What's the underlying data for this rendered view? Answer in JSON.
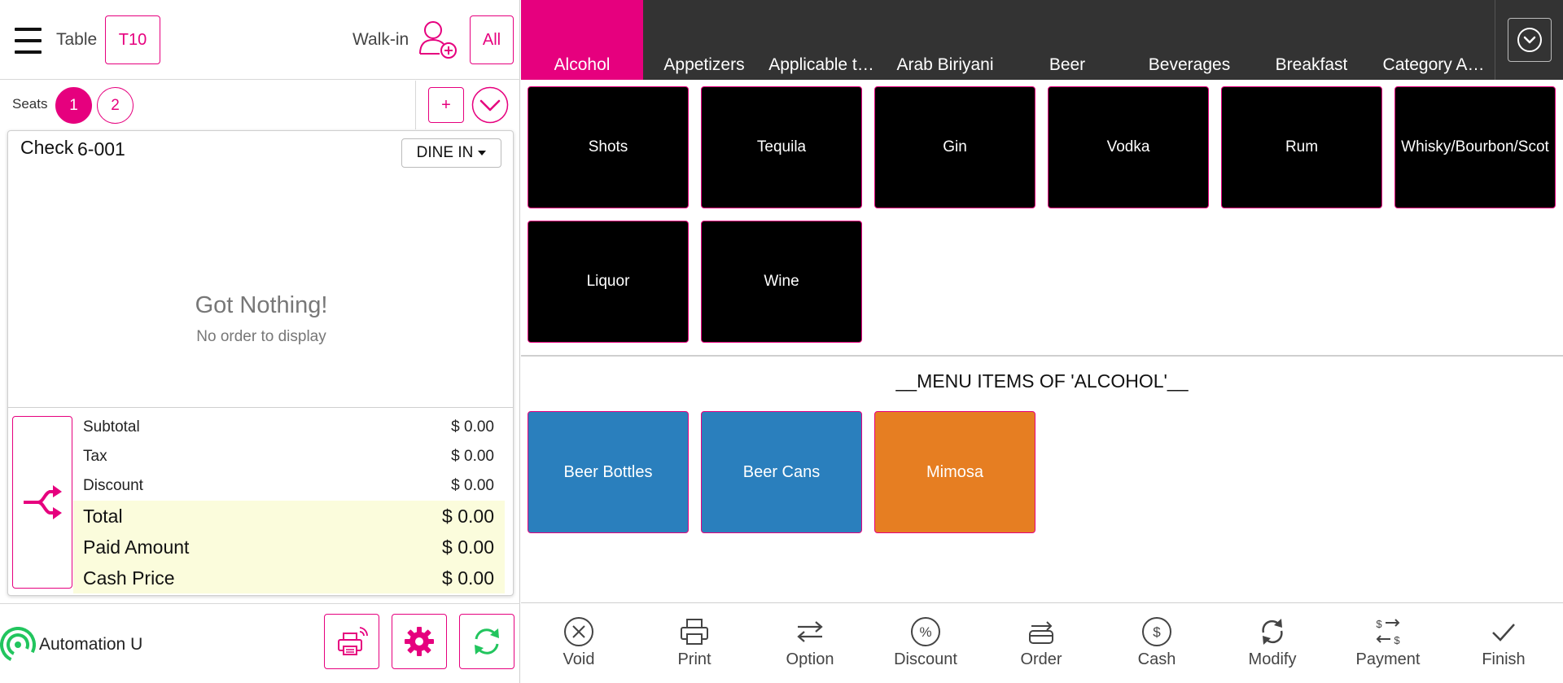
{
  "header": {
    "table_label": "Table",
    "table_value": "T10",
    "walkin_label": "Walk-in",
    "all_label": "All"
  },
  "seats": {
    "label": "Seats",
    "items": [
      "1",
      "2"
    ],
    "active": "1",
    "add_label": "+"
  },
  "check": {
    "label": "Check",
    "number": "6-001",
    "order_type": "DINE IN",
    "empty_title": "Got Nothing!",
    "empty_subtitle": "No order to display"
  },
  "totals": [
    {
      "label": "Subtotal",
      "value": "$ 0.00"
    },
    {
      "label": "Tax",
      "value": "$ 0.00"
    },
    {
      "label": "Discount",
      "value": "$ 0.00"
    },
    {
      "label": "Total",
      "value": "$ 0.00"
    },
    {
      "label": "Paid Amount",
      "value": "$ 0.00"
    },
    {
      "label": "Cash Price",
      "value": "$ 0.00"
    }
  ],
  "footer_left": {
    "user_name": "Automation U"
  },
  "categories": {
    "tabs": [
      "Alcohol",
      "Appetizers",
      "Applicable t…",
      "Arab Biriyani",
      "Beer",
      "Beverages",
      "Breakfast",
      "Category A…"
    ],
    "active": "Alcohol"
  },
  "subcategories": [
    "Shots",
    "Tequila",
    "Gin",
    "Vodka",
    "Rum",
    "Whisky/Bourbon/Scot",
    "Liquor",
    "Wine"
  ],
  "menu": {
    "title": "__MENU ITEMS OF 'ALCOHOL'__",
    "items": [
      {
        "label": "Beer Bottles",
        "color": "#2a7fbd"
      },
      {
        "label": "Beer Cans",
        "color": "#2a7fbd"
      },
      {
        "label": "Mimosa",
        "color": "#e67e22"
      }
    ]
  },
  "actions": [
    {
      "label": "Void",
      "icon": "void-icon"
    },
    {
      "label": "Print",
      "icon": "print-icon"
    },
    {
      "label": "Option",
      "icon": "option-icon"
    },
    {
      "label": "Discount",
      "icon": "discount-icon"
    },
    {
      "label": "Order",
      "icon": "order-icon"
    },
    {
      "label": "Cash",
      "icon": "cash-icon"
    },
    {
      "label": "Modify",
      "icon": "modify-icon"
    },
    {
      "label": "Payment",
      "icon": "payment-icon"
    },
    {
      "label": "Finish",
      "icon": "finish-icon"
    }
  ],
  "colors": {
    "accent": "#e6007e",
    "category_bar": "#333333",
    "online": "#22c55e",
    "refresh": "#22c55e",
    "totals_highlight": "#fbfcdc"
  }
}
